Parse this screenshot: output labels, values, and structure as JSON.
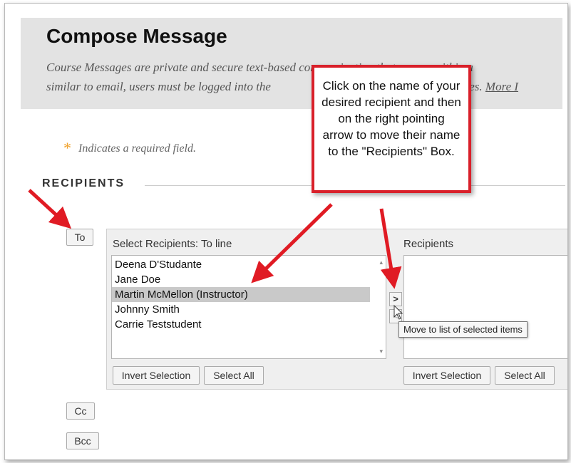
{
  "header": {
    "title": "Compose Message",
    "description_line1": "Course Messages are private and secure text-based communication that occurs within a",
    "description_line2": "similar to email, users must be logged into the",
    "description_line2_end": "essages.",
    "more_link": "More I"
  },
  "required_note": {
    "asterisk": "*",
    "text": "Indicates a required field."
  },
  "recipients_section": {
    "title": "RECIPIENTS",
    "to_button": "To",
    "cc_button": "Cc",
    "bcc_button": "Bcc",
    "select_label": "Select Recipients: To line",
    "recipients_label": "Recipients",
    "available": [
      {
        "name": "Deena D'Studante",
        "selected": false
      },
      {
        "name": "Jane Doe",
        "selected": false
      },
      {
        "name": "Martin McMellon (Instructor)",
        "selected": true
      },
      {
        "name": "Johnny Smith",
        "selected": false
      },
      {
        "name": "Carrie Teststudent",
        "selected": false
      }
    ],
    "invert_selection_left": "Invert Selection",
    "select_all_left": "Select All",
    "invert_selection_right": "Invert Selection",
    "select_all_right": "Select All",
    "move_right_glyph": ">",
    "move_left_glyph": "<",
    "tooltip": "Move to list of selected items"
  },
  "callout": {
    "text": "Click on the name of your desired recipient and then on the right pointing arrow to move their name to the \"Recipients\" Box."
  },
  "colors": {
    "callout_border": "#d9202a",
    "annotation_arrow": "#e01b24",
    "header_bg": "#e3e3e3",
    "required_asterisk": "#f0a028"
  }
}
